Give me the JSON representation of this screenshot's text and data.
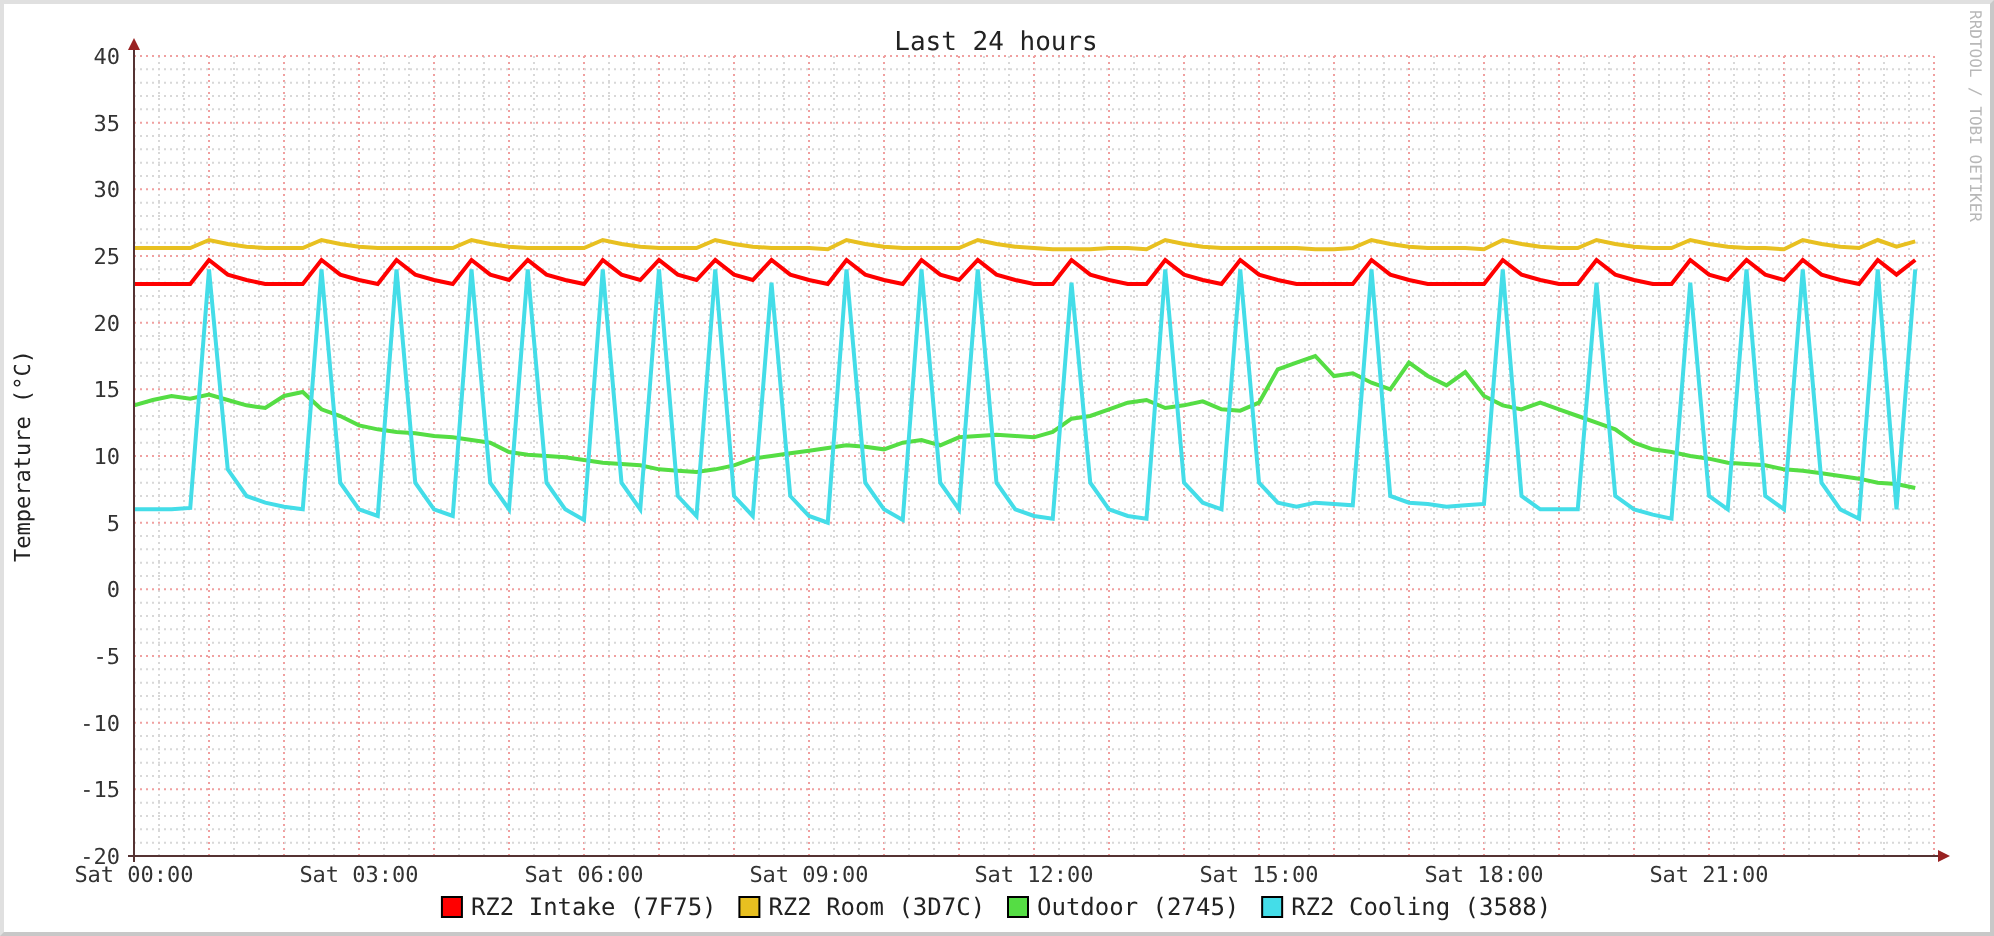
{
  "graph": {
    "signature": "RRDTOOL / TOBI OETIKER",
    "chart_data": {
      "type": "line",
      "title": "Last 24 hours",
      "ylabel": "Temperature (°C)",
      "categories": [
        "Sat 00:00",
        null,
        null,
        null,
        null,
        null,
        null,
        null,
        null,
        null,
        null,
        null,
        "Sat 03:00",
        null,
        null,
        null,
        null,
        null,
        null,
        null,
        null,
        null,
        null,
        null,
        "Sat 06:00",
        null,
        null,
        null,
        null,
        null,
        null,
        null,
        null,
        null,
        null,
        null,
        "Sat 09:00",
        null,
        null,
        null,
        null,
        null,
        null,
        null,
        null,
        null,
        null,
        null,
        "Sat 12:00",
        null,
        null,
        null,
        null,
        null,
        null,
        null,
        null,
        null,
        null,
        null,
        "Sat 15:00",
        null,
        null,
        null,
        null,
        null,
        null,
        null,
        null,
        null,
        null,
        null,
        "Sat 18:00",
        null,
        null,
        null,
        null,
        null,
        null,
        null,
        null,
        null,
        null,
        null,
        "Sat 21:00",
        null,
        null,
        null,
        null,
        null,
        null,
        null,
        null,
        null,
        null,
        null
      ],
      "ylim": [
        -20,
        40
      ],
      "grid": true,
      "legend": "bottom",
      "yticks": [
        -20,
        -15,
        -10,
        -5,
        0,
        5,
        10,
        15,
        20,
        25,
        30,
        35,
        40
      ],
      "series": [
        {
          "name": "RZ2 Intake (7F75)",
          "color": "#ff0000",
          "values": [
            22.9,
            22.9,
            22.9,
            22.9,
            24.7,
            23.6,
            23.2,
            22.9,
            22.9,
            22.9,
            24.7,
            23.6,
            23.2,
            22.9,
            24.7,
            23.6,
            23.2,
            22.9,
            24.7,
            23.6,
            23.2,
            24.7,
            23.6,
            23.2,
            22.9,
            24.7,
            23.6,
            23.2,
            24.7,
            23.6,
            23.2,
            24.7,
            23.6,
            23.2,
            24.7,
            23.6,
            23.2,
            22.9,
            24.7,
            23.6,
            23.2,
            22.9,
            24.7,
            23.6,
            23.2,
            24.7,
            23.6,
            23.2,
            22.9,
            22.9,
            24.7,
            23.6,
            23.2,
            22.9,
            22.9,
            24.7,
            23.6,
            23.2,
            22.9,
            24.7,
            23.6,
            23.2,
            22.9,
            22.9,
            22.9,
            22.9,
            24.7,
            23.6,
            23.2,
            22.9,
            22.9,
            22.9,
            22.9,
            24.7,
            23.6,
            23.2,
            22.9,
            22.9,
            24.7,
            23.6,
            23.2,
            22.9,
            22.9,
            24.7,
            23.6,
            23.2,
            24.7,
            23.6,
            23.2,
            24.7,
            23.6,
            23.2,
            22.9,
            24.7,
            23.6,
            24.7
          ]
        },
        {
          "name": "RZ2 Room (3D7C)",
          "color": "#e8c020",
          "values": [
            25.6,
            25.6,
            25.6,
            25.6,
            26.2,
            25.9,
            25.7,
            25.6,
            25.6,
            25.6,
            26.2,
            25.9,
            25.7,
            25.6,
            25.6,
            25.6,
            25.6,
            25.6,
            26.2,
            25.9,
            25.7,
            25.6,
            25.6,
            25.6,
            25.6,
            26.2,
            25.9,
            25.7,
            25.6,
            25.6,
            25.6,
            26.2,
            25.9,
            25.7,
            25.6,
            25.6,
            25.6,
            25.5,
            26.2,
            25.9,
            25.7,
            25.6,
            25.6,
            25.6,
            25.6,
            26.2,
            25.9,
            25.7,
            25.6,
            25.5,
            25.5,
            25.5,
            25.6,
            25.6,
            25.5,
            26.2,
            25.9,
            25.7,
            25.6,
            25.6,
            25.6,
            25.6,
            25.6,
            25.5,
            25.5,
            25.6,
            26.2,
            25.9,
            25.7,
            25.6,
            25.6,
            25.6,
            25.5,
            26.2,
            25.9,
            25.7,
            25.6,
            25.6,
            26.2,
            25.9,
            25.7,
            25.6,
            25.6,
            26.2,
            25.9,
            25.7,
            25.6,
            25.6,
            25.5,
            26.2,
            25.9,
            25.7,
            25.6,
            26.2,
            25.7,
            26.1
          ]
        },
        {
          "name": "Outdoor (2745)",
          "color": "#55dd44",
          "values": [
            13.8,
            14.2,
            14.5,
            14.3,
            14.6,
            14.2,
            13.8,
            13.6,
            14.5,
            14.8,
            13.5,
            13.0,
            12.3,
            12.0,
            11.8,
            11.7,
            11.5,
            11.4,
            11.2,
            11.0,
            10.3,
            10.1,
            10.0,
            9.9,
            9.7,
            9.5,
            9.4,
            9.3,
            9.0,
            8.9,
            8.8,
            9.0,
            9.3,
            9.8,
            10.0,
            10.2,
            10.4,
            10.6,
            10.8,
            10.7,
            10.5,
            11.0,
            11.2,
            10.8,
            11.4,
            11.5,
            11.6,
            11.5,
            11.4,
            11.8,
            12.8,
            13.0,
            13.5,
            14.0,
            14.2,
            13.6,
            13.8,
            14.1,
            13.5,
            13.4,
            14.0,
            16.5,
            17.0,
            17.5,
            16.0,
            16.2,
            15.5,
            15.0,
            17.0,
            16.0,
            15.3,
            16.3,
            14.5,
            13.8,
            13.5,
            14.0,
            13.5,
            13.0,
            12.5,
            12.0,
            11.0,
            10.5,
            10.3,
            10.0,
            9.8,
            9.5,
            9.4,
            9.3,
            9.0,
            8.9,
            8.7,
            8.5,
            8.3,
            8.0,
            7.9,
            7.6
          ]
        },
        {
          "name": "RZ2 Cooling (3588)",
          "color": "#44dde8",
          "values": [
            6,
            6,
            6,
            6.1,
            24,
            9,
            7,
            6.5,
            6.2,
            6,
            24,
            8,
            6,
            5.5,
            24,
            8,
            6,
            5.5,
            24,
            8,
            6,
            24,
            8,
            6,
            5.2,
            24,
            8,
            6,
            24,
            7,
            5.5,
            24,
            7,
            5.5,
            23,
            7,
            5.5,
            5,
            24,
            8,
            6,
            5.2,
            24,
            8,
            6,
            24,
            8,
            6,
            5.5,
            5.3,
            23,
            8,
            6,
            5.5,
            5.3,
            24,
            8,
            6.5,
            6,
            24,
            8,
            6.5,
            6.2,
            6.5,
            6.4,
            6.3,
            24,
            7,
            6.5,
            6.4,
            6.2,
            6.3,
            6.4,
            24,
            7,
            6,
            6,
            6,
            23,
            7,
            6,
            5.6,
            5.3,
            23,
            7,
            6,
            24,
            7,
            6,
            24,
            8,
            6,
            5.3,
            24,
            6,
            24
          ]
        }
      ]
    }
  }
}
